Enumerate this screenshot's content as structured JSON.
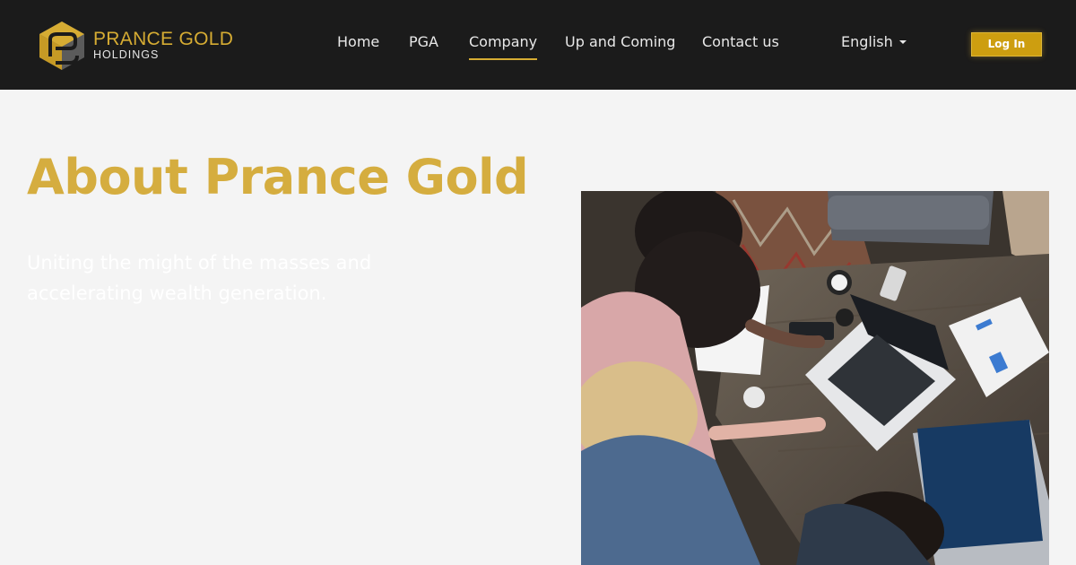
{
  "brand": {
    "name_line1": "PRANCE GOLD",
    "name_line2": "HOLDINGS",
    "gold": "#d6ac33",
    "dark": "#1b1b1b"
  },
  "nav": {
    "items": [
      {
        "label": "Home",
        "active": false
      },
      {
        "label": "PGA",
        "active": false
      },
      {
        "label": "Company",
        "active": true
      },
      {
        "label": "Up and Coming",
        "active": false
      },
      {
        "label": "Contact us",
        "active": false
      }
    ],
    "language": "English",
    "login_label": "Log In"
  },
  "hero": {
    "title": "About Prance Gold",
    "subtitle": "Uniting the might of the masses and accelerating wealth generation.",
    "image_icon": "team-meeting-photo"
  }
}
